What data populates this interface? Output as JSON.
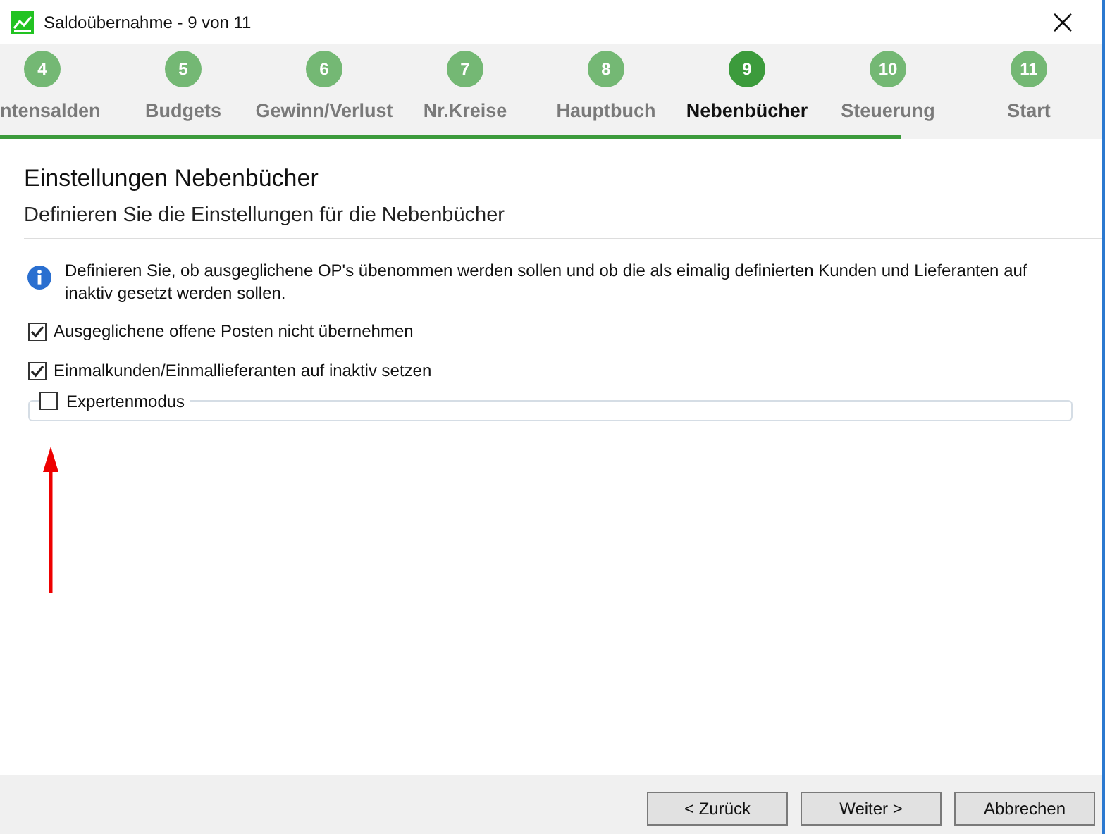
{
  "window": {
    "title": "Saldoübernahme - 9 von 11"
  },
  "steps": [
    {
      "number": "4",
      "label": "ntensalden",
      "selected": false
    },
    {
      "number": "5",
      "label": "Budgets",
      "selected": false
    },
    {
      "number": "6",
      "label": "Gewinn/Verlust",
      "selected": false
    },
    {
      "number": "7",
      "label": "Nr.Kreise",
      "selected": false
    },
    {
      "number": "8",
      "label": "Hauptbuch",
      "selected": false
    },
    {
      "number": "9",
      "label": "Nebenbücher",
      "selected": true
    },
    {
      "number": "10",
      "label": "Steuerung",
      "selected": false
    },
    {
      "number": "11",
      "label": "Start",
      "selected": false
    }
  ],
  "progress": {
    "level": 0.817
  },
  "heading": "Einstellungen Nebenbücher",
  "subheading": "Definieren Sie die Einstellungen für die Nebenbücher",
  "info": "Definieren Sie, ob ausgeglichene OP's übenommen werden sollen und ob die als eimalig definierten Kunden und Lieferanten auf inaktiv gesetzt werden sollen.",
  "options": [
    {
      "label": "Ausgeglichene offene Posten nicht übernehmen",
      "checked": true
    },
    {
      "label": "Einmalkunden/Einmallieferanten auf inaktiv setzen",
      "checked": true
    }
  ],
  "expert_group": {
    "label": "Expertenmodus",
    "checked": false
  },
  "buttons": [
    "< Zurück",
    "Weiter >",
    "Abbrechen"
  ]
}
